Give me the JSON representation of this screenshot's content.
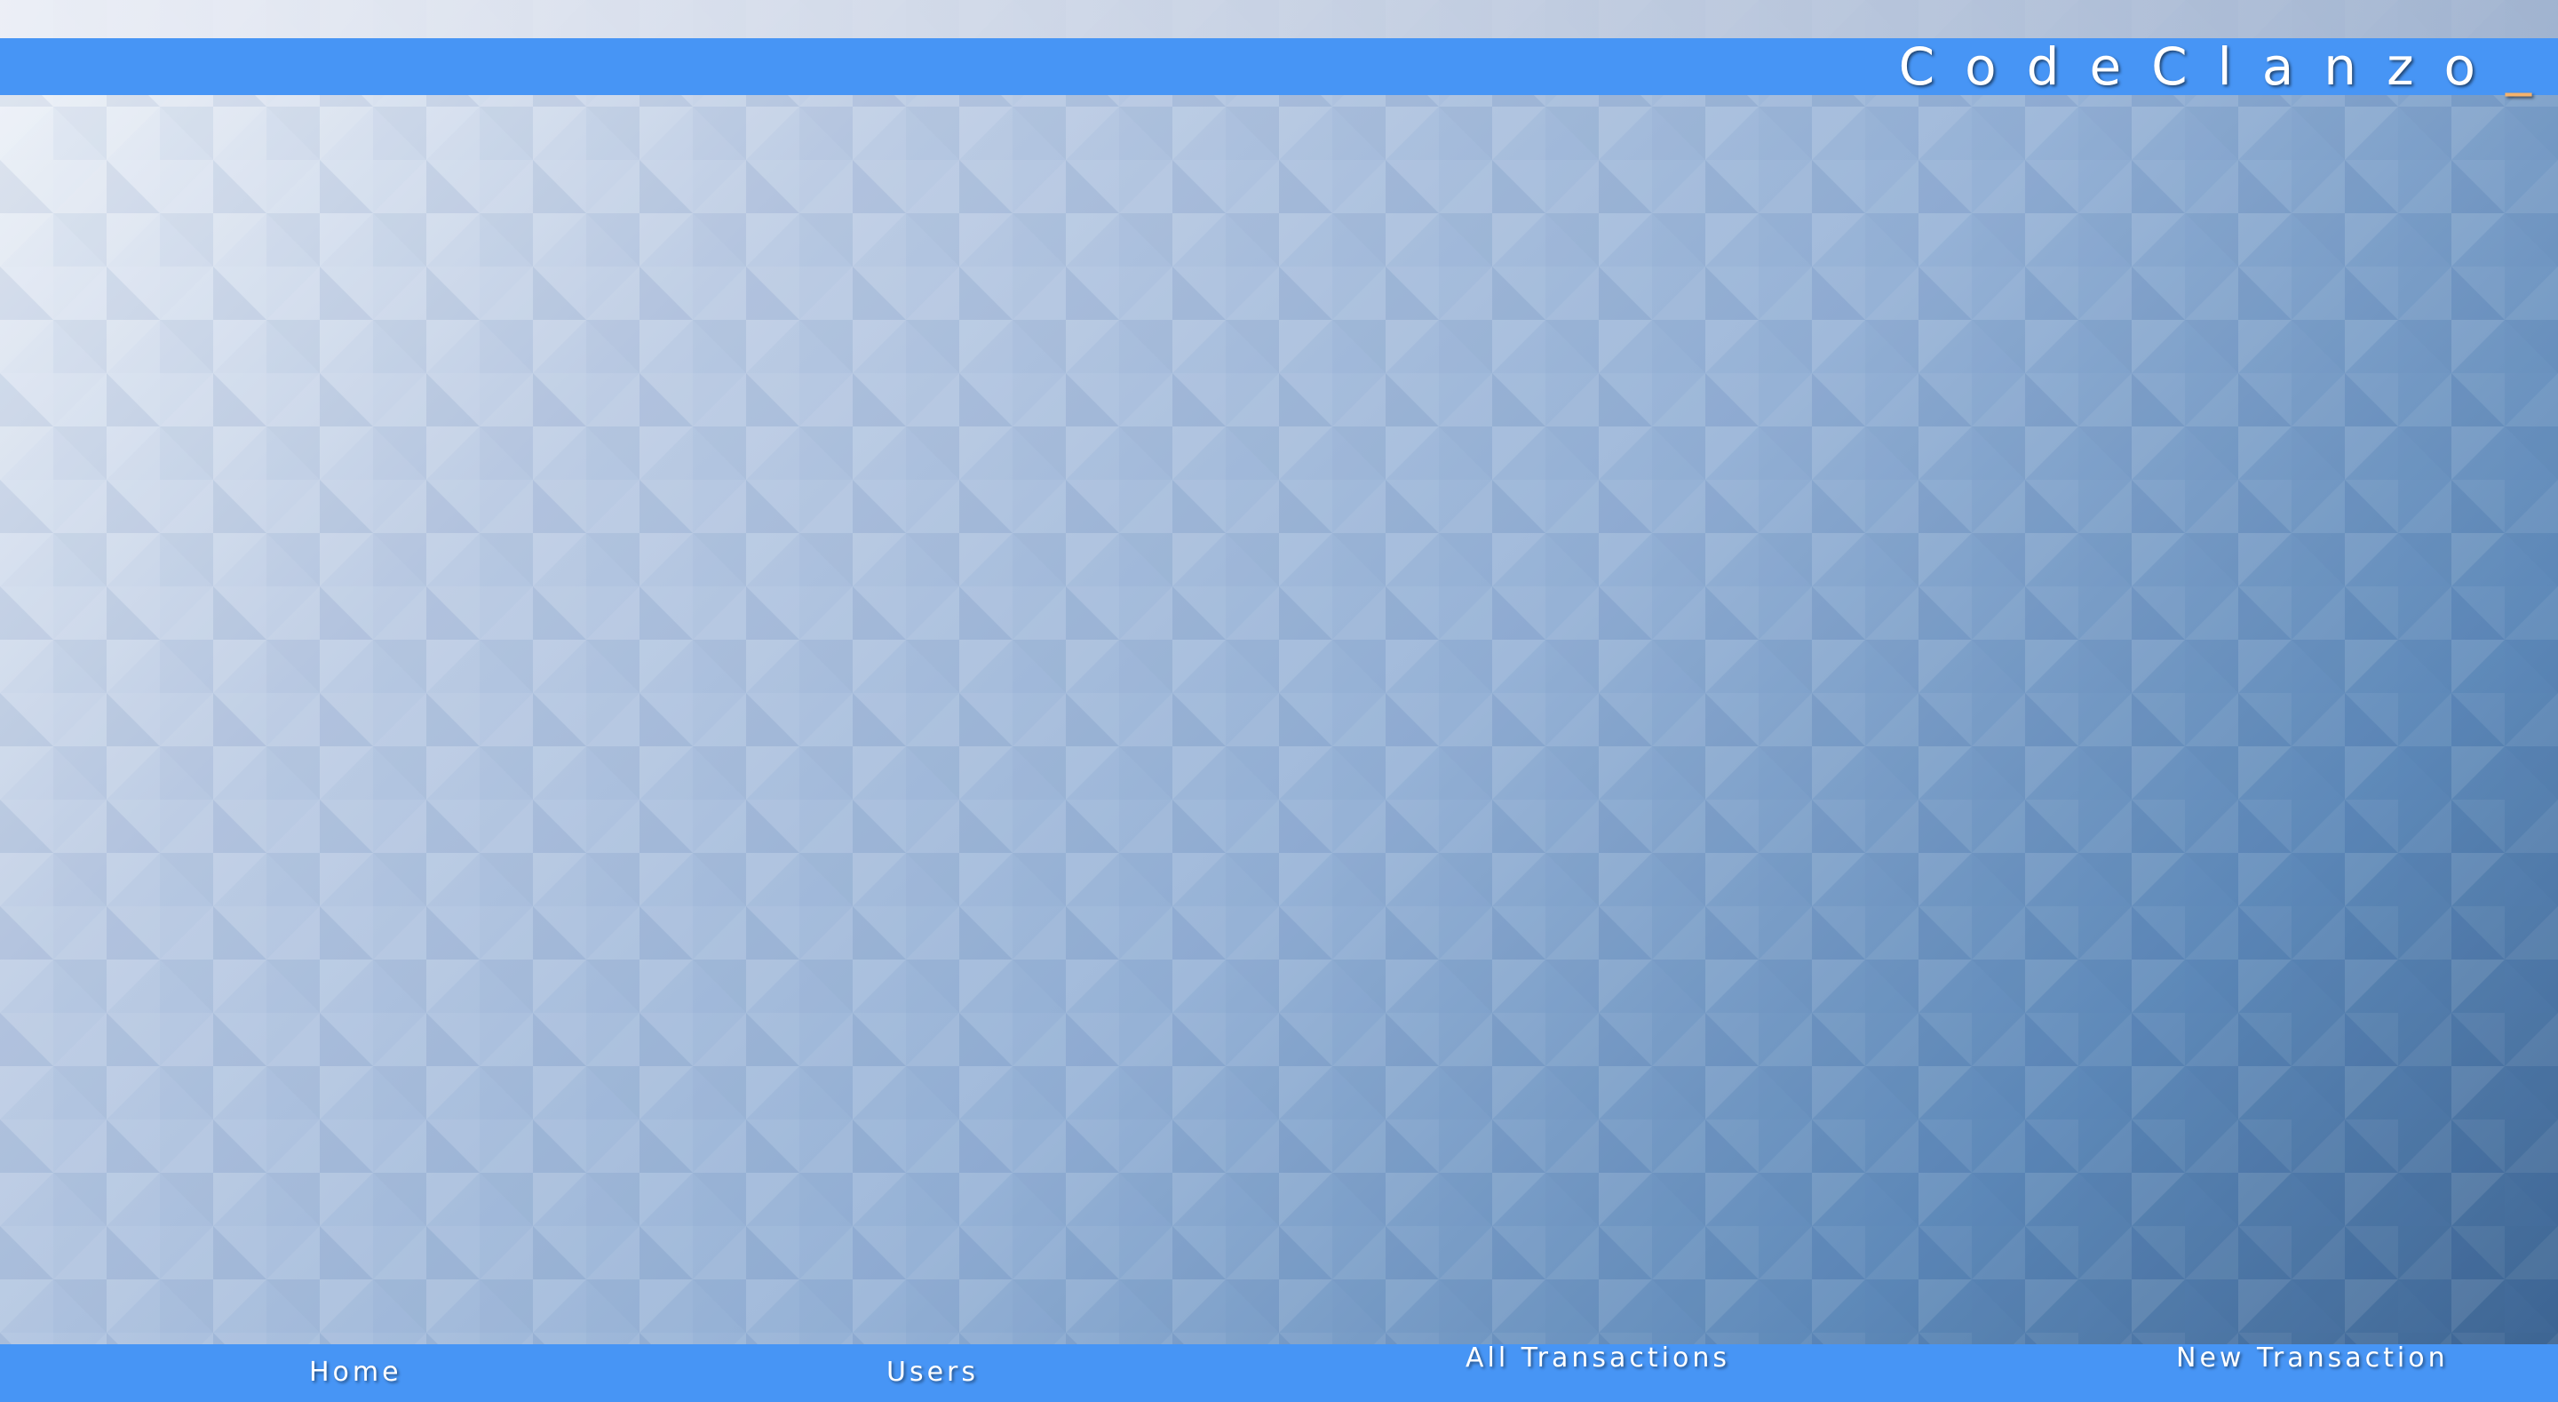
{
  "header": {
    "brand": "CodeClanzo",
    "brand_cursor": "_"
  },
  "nav": {
    "items": [
      {
        "label": "Home"
      },
      {
        "label": "Users"
      },
      {
        "label": "All Transactions"
      },
      {
        "label": "New Transaction"
      }
    ]
  },
  "colors": {
    "bar": "#4795f5",
    "text": "#ffffff",
    "cursor": "#f6b26b"
  }
}
